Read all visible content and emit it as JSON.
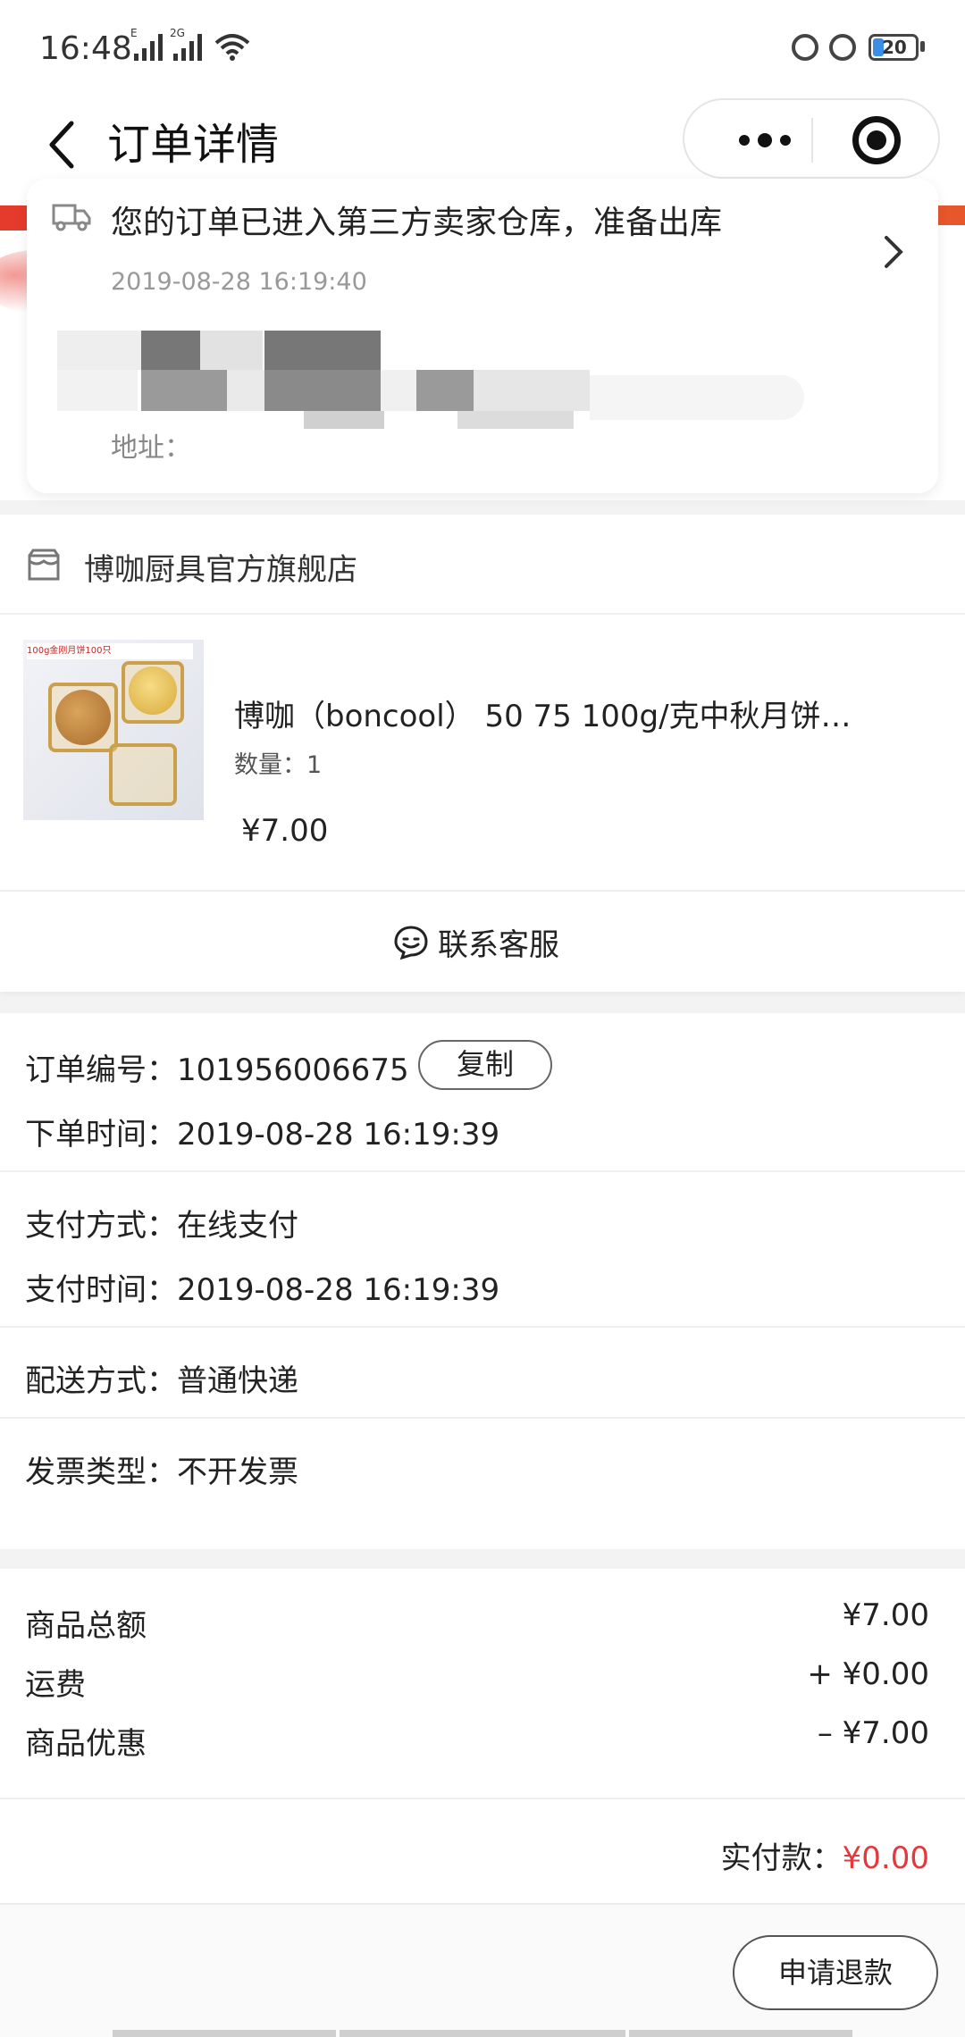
{
  "status_bar": {
    "time": "16:48",
    "network_1": "E",
    "network_2": "2G",
    "battery": "20"
  },
  "nav": {
    "title": "订单详情",
    "back_icon": "chevron-left-icon",
    "more_icon": "more-dots-icon",
    "close_icon": "target-icon"
  },
  "logistics": {
    "status": "您的订单已进入第三方卖家仓库，准备出库",
    "time": "2019-08-28 16:19:40",
    "address_label": "地址："
  },
  "store": {
    "name": "博咖厨具官方旗舰店"
  },
  "product": {
    "title": "博咖（boncool） 50 75 100g/克中秋月饼…",
    "quantity": "数量：1",
    "price": "¥7.00",
    "image_banner": "100g金刚月饼100只"
  },
  "contact": {
    "label": "联系客服"
  },
  "order_info": {
    "order_no_label": "订单编号：",
    "order_no": "101956006675",
    "copy_label": "复制",
    "order_time_label": "下单时间：",
    "order_time": "2019-08-28 16:19:39",
    "payment_method_label": "支付方式：",
    "payment_method": "在线支付",
    "payment_time_label": "支付时间：",
    "payment_time": "2019-08-28 16:19:39",
    "delivery_label": "配送方式：",
    "delivery": "普通快递",
    "invoice_label": "发票类型：",
    "invoice": "不开发票"
  },
  "summary": {
    "goods_total_label": "商品总额",
    "goods_total": "¥7.00",
    "shipping_label": "运费",
    "shipping": "+ ¥0.00",
    "discount_label": "商品优惠",
    "discount": "– ¥7.00",
    "paid_label": "实付款：",
    "paid": "¥0.00"
  },
  "actions": {
    "refund_label": "申请退款"
  },
  "colors": {
    "accent_red": "#e4393c",
    "header_red": "#e43b2c"
  }
}
